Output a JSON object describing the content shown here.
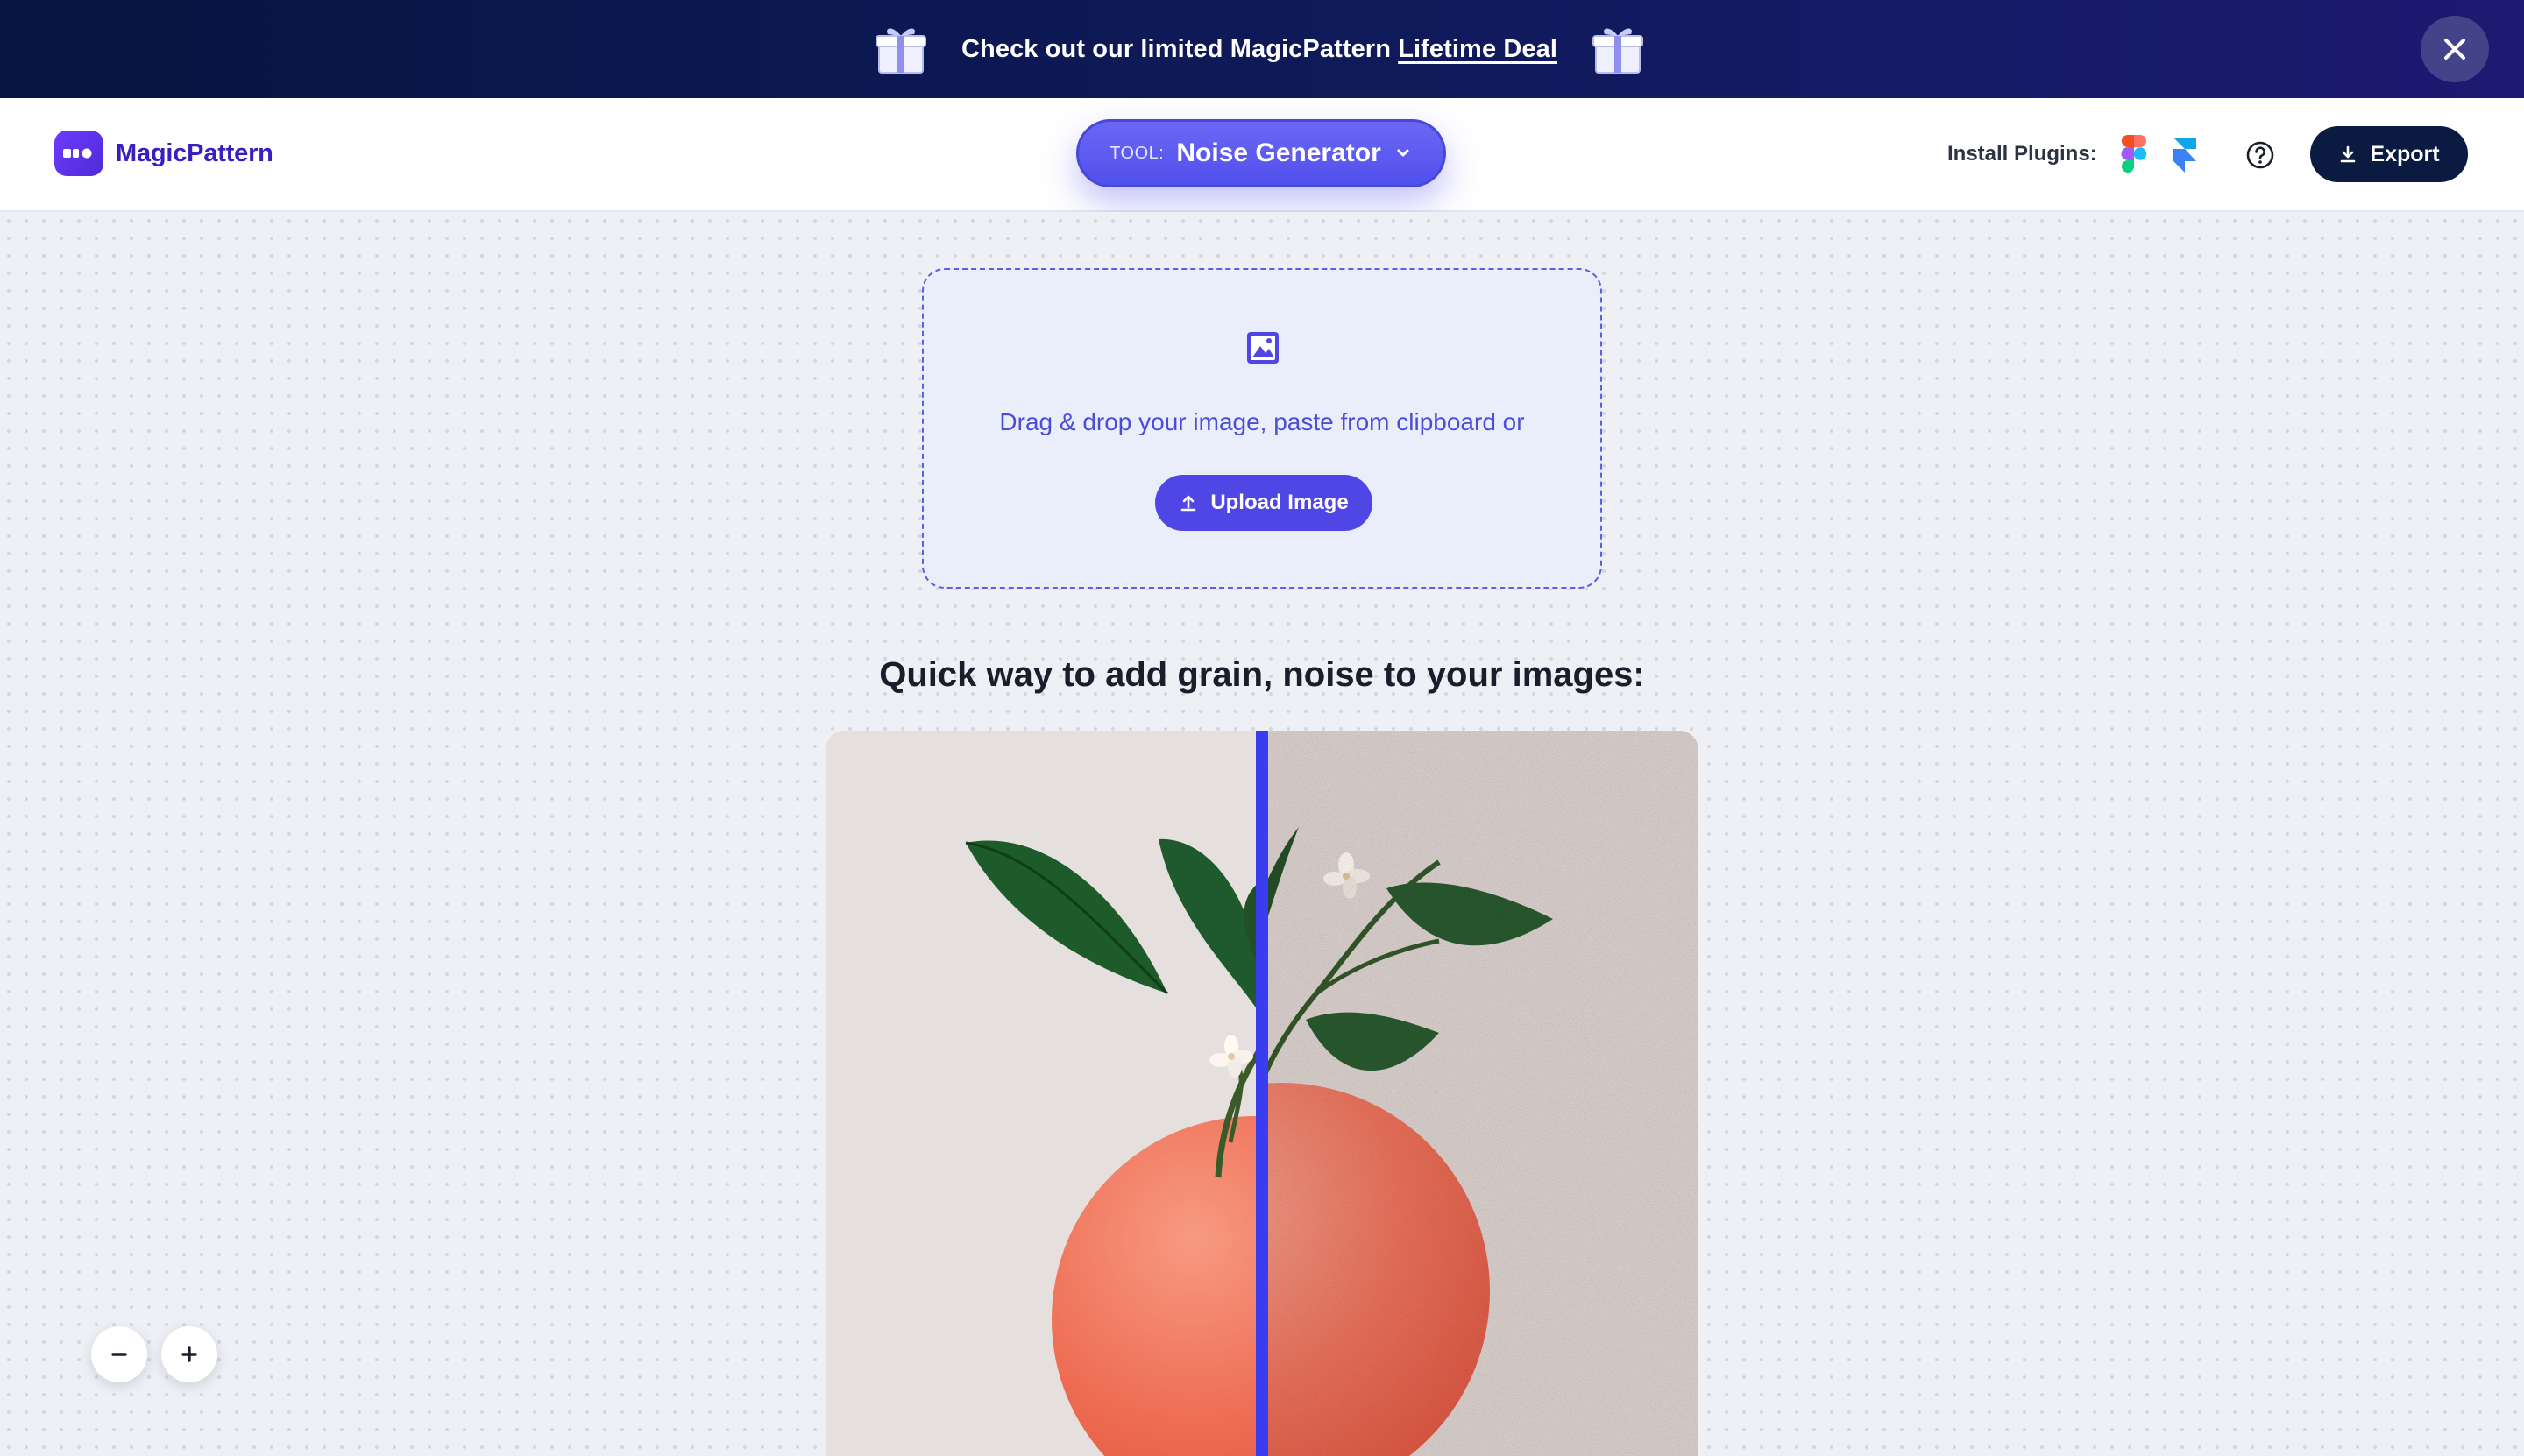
{
  "promo": {
    "text": "Check out our limited MagicPattern",
    "link": "Lifetime Deal"
  },
  "header": {
    "brand": "MagicPattern",
    "tool_prefix": "TOOL:",
    "tool_name": "Noise Generator",
    "plugins_label": "Install Plugins:",
    "export_label": "Export"
  },
  "upload": {
    "prompt": "Drag & drop your image, paste from clipboard or",
    "button_label": "Upload Image"
  },
  "main": {
    "headline": "Quick way to add grain, noise to your images:"
  },
  "compare": {
    "split_position_percent": 50
  },
  "icons": {
    "gift": "gift-icon",
    "close": "close-icon",
    "logo": "magicpattern-logo-icon",
    "chevron": "chevron-down-icon",
    "figma": "figma-icon",
    "framer": "framer-icon",
    "help": "help-icon",
    "download": "download-icon",
    "image": "image-icon",
    "upload": "upload-icon",
    "zoom_out": "minus-icon",
    "zoom_in": "plus-icon"
  },
  "colors": {
    "accent": "#4f46e5",
    "banner_dark": "#071541",
    "export_dark": "#0b1a40",
    "divider": "#3a3cf0"
  }
}
